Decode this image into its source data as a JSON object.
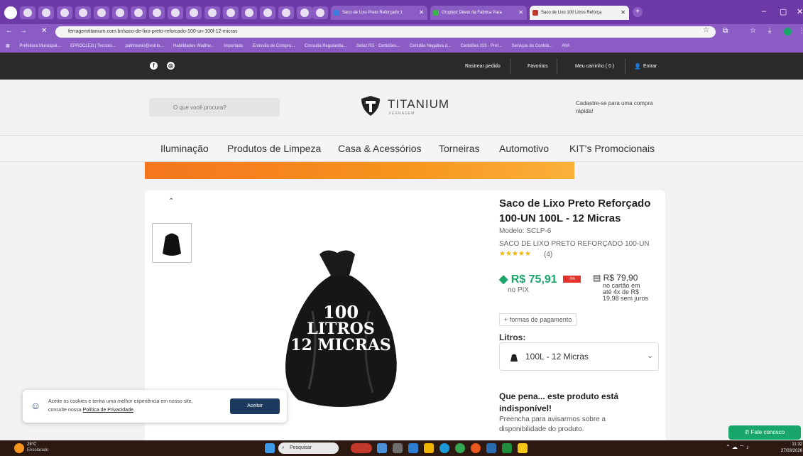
{
  "browser": {
    "tabs": [
      {
        "label": "Saco de Lixo Preto Reforçado 1",
        "active": false
      },
      {
        "label": "Gruplast Direto da Fabrica Para",
        "active": false
      },
      {
        "label": "Saco de Lixo 100 Litros Reforça",
        "active": true
      }
    ],
    "new_tab": "+",
    "url": "ferragemtitanium.com.br/saco-de-lixo-preto-reforcado-100-un-100l-12-micras",
    "bookmarks": [
      "Prefeitura Municipal...",
      "EPROCLEG | Tecnolo...",
      "patrimonio@estrio...",
      "Habilidades Wadhw...",
      "Importado",
      "Emissão de Compro...",
      "Consulta Regularida...",
      "Sefaz RS - Certidões...",
      "Certidão Negativa d...",
      "Certidões ISS - Pref...",
      "Serviços do Contrib...",
      "AVA"
    ]
  },
  "topbar": {
    "track_order": "Rastrear pedido",
    "favorites": "Favoritos",
    "cart": "Meu carrinho ( 0 )",
    "login": "Entrar"
  },
  "header": {
    "search_placeholder": "O que você procura?",
    "logo_name": "TITANIUM",
    "logo_sub": "FERRAGEM",
    "signup": "Cadastre-se para uma compra rápida!"
  },
  "menu": [
    "Iluminação",
    "Produtos de Limpeza",
    "Casa & Acessórios",
    "Torneiras",
    "Automotivo",
    "KIT's Promocionais"
  ],
  "product": {
    "image_text": [
      "100",
      "LITROS",
      "12 MICRAS"
    ],
    "title": "Saco de Lixo Preto Reforçado 100-UN 100L - 12 Micras",
    "model": "Modelo: SCLP-6",
    "subtitle": "SACO DE LIXO PRETO REFORÇADO 100-UN",
    "stars": "★★★★★",
    "reviews": "(4)",
    "pix_price": "R$ 75,91",
    "discount": "-5%",
    "pix_label": "no PIX",
    "card_price": "R$ 79,90",
    "card_line1": "no cartão em",
    "card_line2": "até 4x de R$ 19,98 sem juros",
    "payment_link": "+ formas de pagamento",
    "option_label": "Litros:",
    "option_value": "100L - 12 Micras",
    "unavailable_title": "Que pena... este produto está indisponível!",
    "unavailable_text": "Preencha para avisarmos sobre a disponibilidade do produto."
  },
  "cookie": {
    "text1": "Aceite os cookies e tenha uma melhor experiência em nosso site,",
    "text2": "consulte nossa",
    "link": "Política de Privacidade",
    "button": "Aceitar"
  },
  "chat": "Fale conosco",
  "taskbar": {
    "weather_temp": "28°C",
    "weather_desc": "Ensolarado",
    "search": "Pesquisar",
    "time": "11:32",
    "date": "27/03/2026"
  },
  "colors": {
    "accent": "#18a66a",
    "browser": "#6d3aa8",
    "brand": "#2a2a2a"
  }
}
